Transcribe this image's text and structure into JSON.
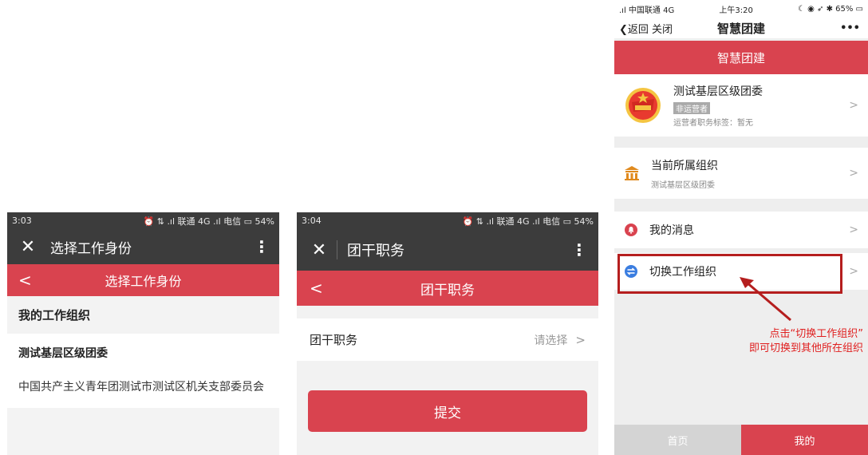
{
  "screen1": {
    "status": {
      "time": "3:03",
      "right": "⏰ ⇅ .ıl 联通 4G .ıl 电信 ▭ 54%"
    },
    "title": "选择工作身份",
    "red_title": "选择工作身份",
    "section_title": "我的工作组织",
    "org_name": "测试基层区级团委",
    "branch_name": "中国共产主义青年团测试市测试区机关支部委员会"
  },
  "screen2": {
    "status": {
      "time": "3:04",
      "right": "⏰ ⇅ .ıl 联通 4G .ıl 电信 ▭ 54%"
    },
    "title": "团干职务",
    "red_title": "团干职务",
    "field_label": "团干职务",
    "field_value": "请选择",
    "submit_label": "提交"
  },
  "screen3": {
    "status": {
      "left": ".ıl 中国联通 4G",
      "time": "上午3:20",
      "right": "☾ ◉ ➶ ✱ 65% ▭"
    },
    "nav_back": "❮返回 关闭",
    "nav_title": "智慧团建",
    "red_title": "智慧团建",
    "profile": {
      "name": "测试基层区级团委",
      "badge": "非运营者",
      "tag": "运营者职务标签：暂无"
    },
    "current_org_label": "当前所属组织",
    "current_org_value": "测试基层区级团委",
    "messages_label": "我的消息",
    "switch_label": "切换工作组织",
    "annotation_line1": "点击“切换工作组织”",
    "annotation_line2": "即可切换到其他所在组织",
    "tabs": {
      "home": "首页",
      "mine": "我的"
    }
  },
  "colors": {
    "accent": "#d9434f",
    "dark_bar": "#3c3c3c",
    "annotation": "#e02020"
  }
}
